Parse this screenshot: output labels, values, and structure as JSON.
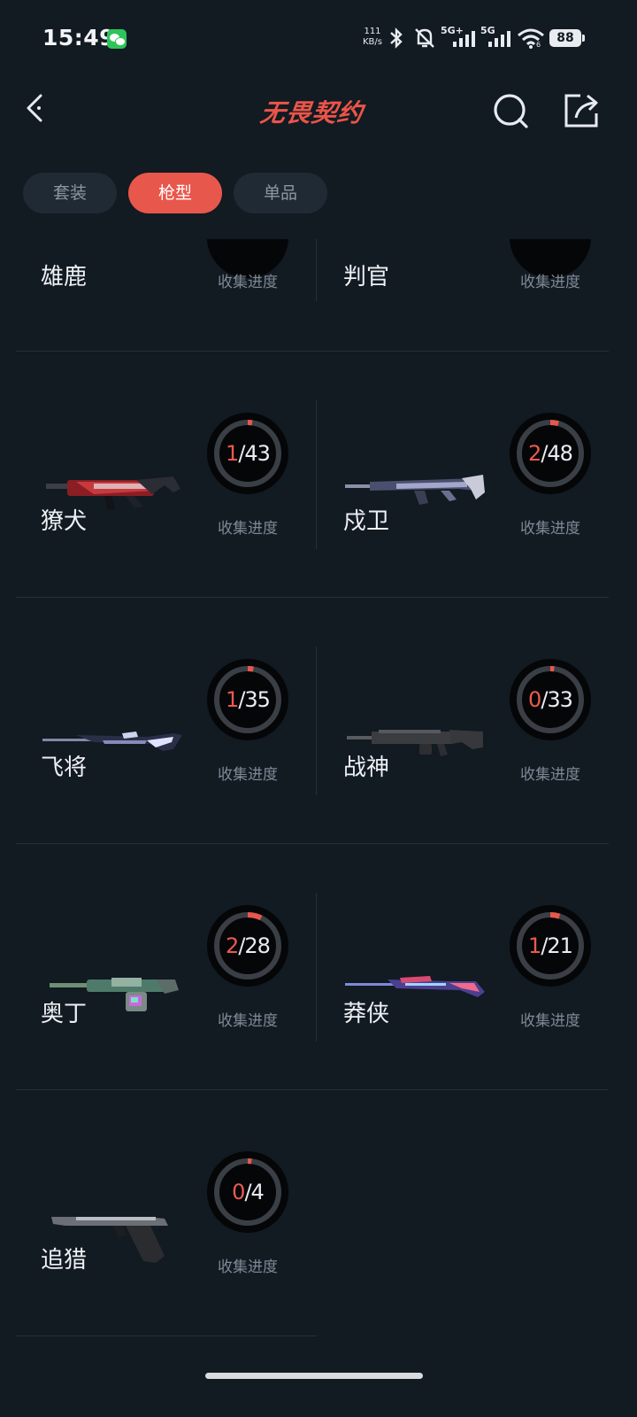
{
  "status_bar": {
    "time": "15:49",
    "net_speed_value": "111",
    "net_speed_unit": "KB/s",
    "signal1_label": "5G+",
    "signal2_label": "5G",
    "wifi_badge": "6",
    "battery": "88"
  },
  "header": {
    "logo_text": "无畏契约"
  },
  "tabs": [
    {
      "label": "套装",
      "active": false
    },
    {
      "label": "枪型",
      "active": true
    },
    {
      "label": "单品",
      "active": false
    }
  ],
  "progress_label": "收集进度",
  "weapons": [
    {
      "name": "雄鹿"
    },
    {
      "name": "判官"
    },
    {
      "name": "獠犬",
      "owned": "1",
      "total": "/43",
      "fraction": 0.023
    },
    {
      "name": "戍卫",
      "owned": "2",
      "total": "/48",
      "fraction": 0.042
    },
    {
      "name": "飞将",
      "owned": "1",
      "total": "/35",
      "fraction": 0.029
    },
    {
      "name": "战神",
      "owned": "0",
      "total": "/33",
      "fraction": 0.0
    },
    {
      "name": "奥丁",
      "owned": "2",
      "total": "/28",
      "fraction": 0.071
    },
    {
      "name": "莽侠",
      "owned": "1",
      "total": "/21",
      "fraction": 0.048
    },
    {
      "name": "追猎",
      "owned": "0",
      "total": "/4",
      "fraction": 0.0
    }
  ],
  "colors": {
    "background": "#121a22",
    "accent": "#e8574c",
    "ring_track": "#3a3f45",
    "ring_bg": "#050608"
  }
}
